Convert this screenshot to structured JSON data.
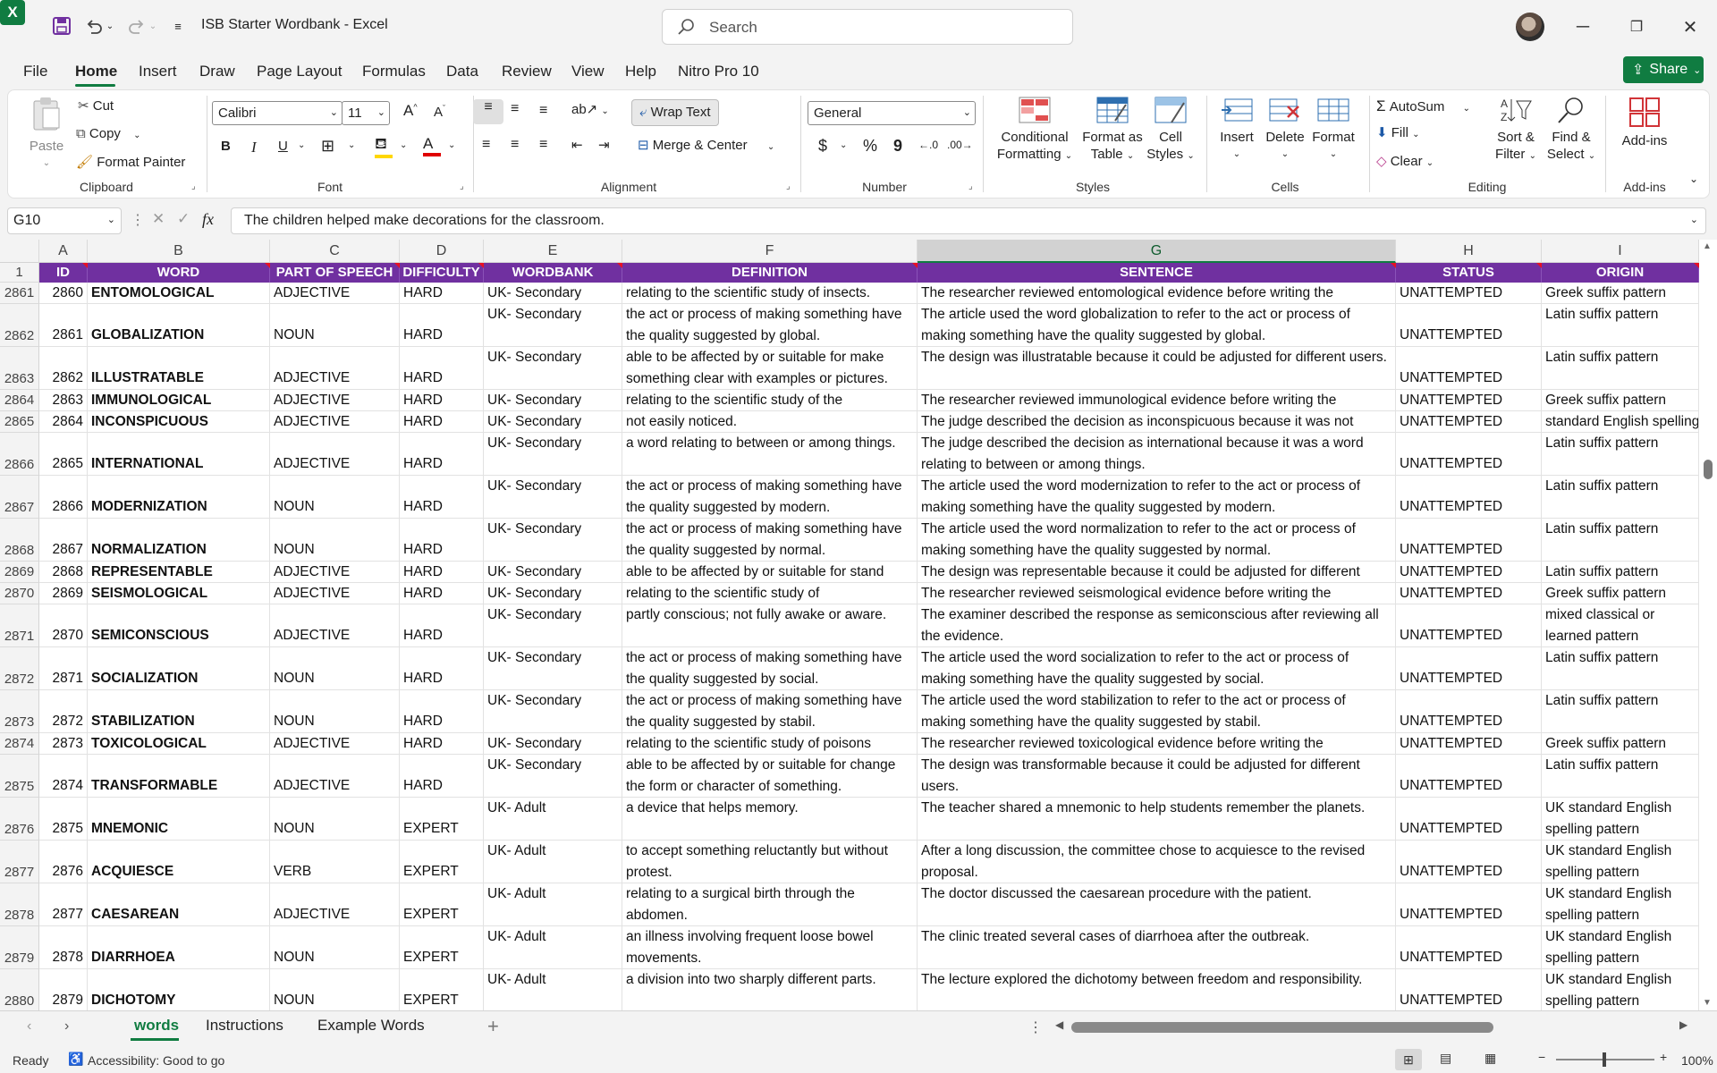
{
  "window": {
    "doc_title": "ISB Starter Wordbank  -  Excel",
    "search_placeholder": "Search",
    "share_label": "Share"
  },
  "menu": [
    "File",
    "Home",
    "Insert",
    "Draw",
    "Page Layout",
    "Formulas",
    "Data",
    "Review",
    "View",
    "Help",
    "Nitro Pro 10"
  ],
  "ribbon": {
    "clipboard": {
      "paste": "Paste",
      "cut": "Cut",
      "copy": "Copy",
      "format_painter": "Format Painter",
      "label": "Clipboard"
    },
    "font": {
      "family": "Calibri",
      "size": "11",
      "label": "Font",
      "bold": "B",
      "italic": "I",
      "underline": "U"
    },
    "alignment": {
      "wrap": "Wrap Text",
      "merge": "Merge & Center",
      "label": "Alignment"
    },
    "number": {
      "format": "General",
      "label": "Number",
      "currency": "$",
      "percent": "%",
      "comma": "9"
    },
    "styles": {
      "conditional": "Conditional",
      "conditional2": "Formatting",
      "format_table": "Format as",
      "format_table2": "Table",
      "cell_styles": "Cell",
      "cell_styles2": "Styles",
      "label": "Styles"
    },
    "cells": {
      "insert": "Insert",
      "delete": "Delete",
      "format": "Format",
      "label": "Cells"
    },
    "editing": {
      "autosum": "AutoSum",
      "fill": "Fill",
      "clear": "Clear",
      "sort": "Sort &",
      "sort2": "Filter",
      "find": "Find &",
      "find2": "Select",
      "label": "Editing"
    },
    "addins": {
      "addins": "Add-ins",
      "label": "Add-ins"
    }
  },
  "formula_bar": {
    "name_box": "G10",
    "formula": "The children helped make decorations for the classroom."
  },
  "columns": [
    "A",
    "B",
    "C",
    "D",
    "E",
    "F",
    "G",
    "H",
    "I"
  ],
  "headers": [
    "ID",
    "WORD",
    "PART OF SPEECH",
    "DIFFICULTY",
    "WORDBANK",
    "DEFINITION",
    "SENTENCE",
    "STATUS",
    "ORIGIN"
  ],
  "header_row_number": "1",
  "rows": [
    {
      "rn": "2861",
      "id": "2860",
      "word": "ENTOMOLOGICAL",
      "pos": "ADJECTIVE",
      "diff": "HARD",
      "bank": "UK-  Secondary",
      "def": "relating to the scientific study of insects.",
      "sent": "The researcher reviewed entomological evidence before writing the",
      "status": "UNATTEMPTED",
      "origin": "Greek suffix pattern",
      "h": 1
    },
    {
      "rn": "2862",
      "id": "2861",
      "word": "GLOBALIZATION",
      "pos": "NOUN",
      "diff": "HARD",
      "bank": "UK-  Secondary",
      "def": "the act or process of making something have the quality suggested by global.",
      "sent": "The article used the word globalization to refer to the act or process of making something have the quality suggested by global.",
      "status": "UNATTEMPTED",
      "origin": "Latin suffix pattern",
      "h": 2
    },
    {
      "rn": "2863",
      "id": "2862",
      "word": "ILLUSTRATABLE",
      "pos": "ADJECTIVE",
      "diff": "HARD",
      "bank": "UK-  Secondary",
      "def": "able to be affected by or suitable for make something clear with examples or pictures.",
      "sent": "The design was illustratable because it could be adjusted for different users.",
      "status": "UNATTEMPTED",
      "origin": "Latin suffix pattern",
      "h": 2
    },
    {
      "rn": "2864",
      "id": "2863",
      "word": "IMMUNOLOGICAL",
      "pos": "ADJECTIVE",
      "diff": "HARD",
      "bank": "UK-  Secondary",
      "def": "relating to the scientific study of the",
      "sent": "The researcher reviewed immunological evidence before writing the",
      "status": "UNATTEMPTED",
      "origin": "Greek suffix pattern",
      "h": 1
    },
    {
      "rn": "2865",
      "id": "2864",
      "word": "INCONSPICUOUS",
      "pos": "ADJECTIVE",
      "diff": "HARD",
      "bank": "UK-  Secondary",
      "def": "not easily noticed.",
      "sent": "The judge described the decision as inconspicuous because it was not",
      "status": "UNATTEMPTED",
      "origin": "standard English spelling",
      "h": 1
    },
    {
      "rn": "2866",
      "id": "2865",
      "word": "INTERNATIONAL",
      "pos": "ADJECTIVE",
      "diff": "HARD",
      "bank": "UK-  Secondary",
      "def": "a word relating to between or among things.",
      "sent": "The judge described the decision as international because it was a word relating to between or among things.",
      "status": "UNATTEMPTED",
      "origin": "Latin suffix pattern",
      "h": 2
    },
    {
      "rn": "2867",
      "id": "2866",
      "word": "MODERNIZATION",
      "pos": "NOUN",
      "diff": "HARD",
      "bank": "UK-  Secondary",
      "def": "the act or process of making something have the quality suggested by modern.",
      "sent": "The article used the word modernization to refer to the act or process of making something have the quality suggested by modern.",
      "status": "UNATTEMPTED",
      "origin": "Latin suffix pattern",
      "h": 2
    },
    {
      "rn": "2868",
      "id": "2867",
      "word": "NORMALIZATION",
      "pos": "NOUN",
      "diff": "HARD",
      "bank": "UK-  Secondary",
      "def": "the act or process of making something have the quality suggested by normal.",
      "sent": "The article used the word normalization to refer to the act or process of making something have the quality suggested by normal.",
      "status": "UNATTEMPTED",
      "origin": "Latin suffix pattern",
      "h": 2
    },
    {
      "rn": "2869",
      "id": "2868",
      "word": "REPRESENTABLE",
      "pos": "ADJECTIVE",
      "diff": "HARD",
      "bank": "UK-  Secondary",
      "def": "able to be affected by or suitable for stand",
      "sent": "The design was representable because it could be adjusted for different",
      "status": "UNATTEMPTED",
      "origin": "Latin suffix pattern",
      "h": 1
    },
    {
      "rn": "2870",
      "id": "2869",
      "word": "SEISMOLOGICAL",
      "pos": "ADJECTIVE",
      "diff": "HARD",
      "bank": "UK-  Secondary",
      "def": "relating to the scientific study of",
      "sent": "The researcher reviewed seismological evidence before writing the",
      "status": "UNATTEMPTED",
      "origin": "Greek suffix pattern",
      "h": 1
    },
    {
      "rn": "2871",
      "id": "2870",
      "word": "SEMICONSCIOUS",
      "pos": "ADJECTIVE",
      "diff": "HARD",
      "bank": "UK-  Secondary",
      "def": "partly conscious; not fully awake or aware.",
      "sent": "The examiner described the response as semiconscious after reviewing all the evidence.",
      "status": "UNATTEMPTED",
      "origin": "mixed classical or learned pattern",
      "h": 2
    },
    {
      "rn": "2872",
      "id": "2871",
      "word": "SOCIALIZATION",
      "pos": "NOUN",
      "diff": "HARD",
      "bank": "UK-  Secondary",
      "def": "the act or process of making something have the quality suggested by social.",
      "sent": "The article used the word socialization to refer to the act or process of making something have the quality suggested by social.",
      "status": "UNATTEMPTED",
      "origin": "Latin suffix pattern",
      "h": 2
    },
    {
      "rn": "2873",
      "id": "2872",
      "word": "STABILIZATION",
      "pos": "NOUN",
      "diff": "HARD",
      "bank": "UK-  Secondary",
      "def": "the act or process of making something have the quality suggested by stabil.",
      "sent": "The article used the word stabilization to refer to the act or process of making something have the quality suggested by stabil.",
      "status": "UNATTEMPTED",
      "origin": "Latin suffix pattern",
      "h": 2
    },
    {
      "rn": "2874",
      "id": "2873",
      "word": "TOXICOLOGICAL",
      "pos": "ADJECTIVE",
      "diff": "HARD",
      "bank": "UK-  Secondary",
      "def": "relating to the scientific study of poisons",
      "sent": "The researcher reviewed toxicological evidence before writing the",
      "status": "UNATTEMPTED",
      "origin": "Greek suffix pattern",
      "h": 1
    },
    {
      "rn": "2875",
      "id": "2874",
      "word": "TRANSFORMABLE",
      "pos": "ADJECTIVE",
      "diff": "HARD",
      "bank": "UK-  Secondary",
      "def": "able to be affected by or suitable for change the form or character of something.",
      "sent": "The design was transformable because it could be adjusted for different users.",
      "status": "UNATTEMPTED",
      "origin": "Latin suffix pattern",
      "h": 2
    },
    {
      "rn": "2876",
      "id": "2875",
      "word": "MNEMONIC",
      "pos": "NOUN",
      "diff": "EXPERT",
      "bank": "UK-  Adult",
      "def": "a device that helps memory.",
      "sent": "The teacher shared a mnemonic to help students remember the planets.",
      "status": "UNATTEMPTED",
      "origin": "UK standard English spelling pattern",
      "h": 2
    },
    {
      "rn": "2877",
      "id": "2876",
      "word": "ACQUIESCE",
      "pos": "VERB",
      "diff": "EXPERT",
      "bank": "UK-  Adult",
      "def": "to accept something reluctantly but without protest.",
      "sent": "After a long discussion, the committee chose to acquiesce to the revised proposal.",
      "status": "UNATTEMPTED",
      "origin": "UK standard English spelling pattern",
      "h": 2
    },
    {
      "rn": "2878",
      "id": "2877",
      "word": "CAESAREAN",
      "pos": "ADJECTIVE",
      "diff": "EXPERT",
      "bank": "UK-  Adult",
      "def": "relating to a surgical birth through the abdomen.",
      "sent": "The doctor discussed the caesarean procedure with the patient.",
      "status": "UNATTEMPTED",
      "origin": "UK standard English spelling pattern",
      "h": 2
    },
    {
      "rn": "2879",
      "id": "2878",
      "word": "DIARRHOEA",
      "pos": "NOUN",
      "diff": "EXPERT",
      "bank": "UK-  Adult",
      "def": "an illness involving frequent loose bowel movements.",
      "sent": "The clinic treated several cases of diarrhoea after the outbreak.",
      "status": "UNATTEMPTED",
      "origin": "UK standard English spelling pattern",
      "h": 2
    },
    {
      "rn": "2880",
      "id": "2879",
      "word": "DICHOTOMY",
      "pos": "NOUN",
      "diff": "EXPERT",
      "bank": "UK-  Adult",
      "def": "a division into two sharply different parts.",
      "sent": "The lecture explored the dichotomy between freedom and responsibility.",
      "status": "UNATTEMPTED",
      "origin": "UK standard English spelling pattern",
      "h": 2
    }
  ],
  "sheets": [
    "words",
    "Instructions",
    "Example Words"
  ],
  "status": {
    "ready": "Ready",
    "accessibility": "Accessibility: Good to go",
    "zoom": "100%"
  },
  "colors": {
    "accent": "#107c41",
    "header_bg": "#7030a0"
  }
}
